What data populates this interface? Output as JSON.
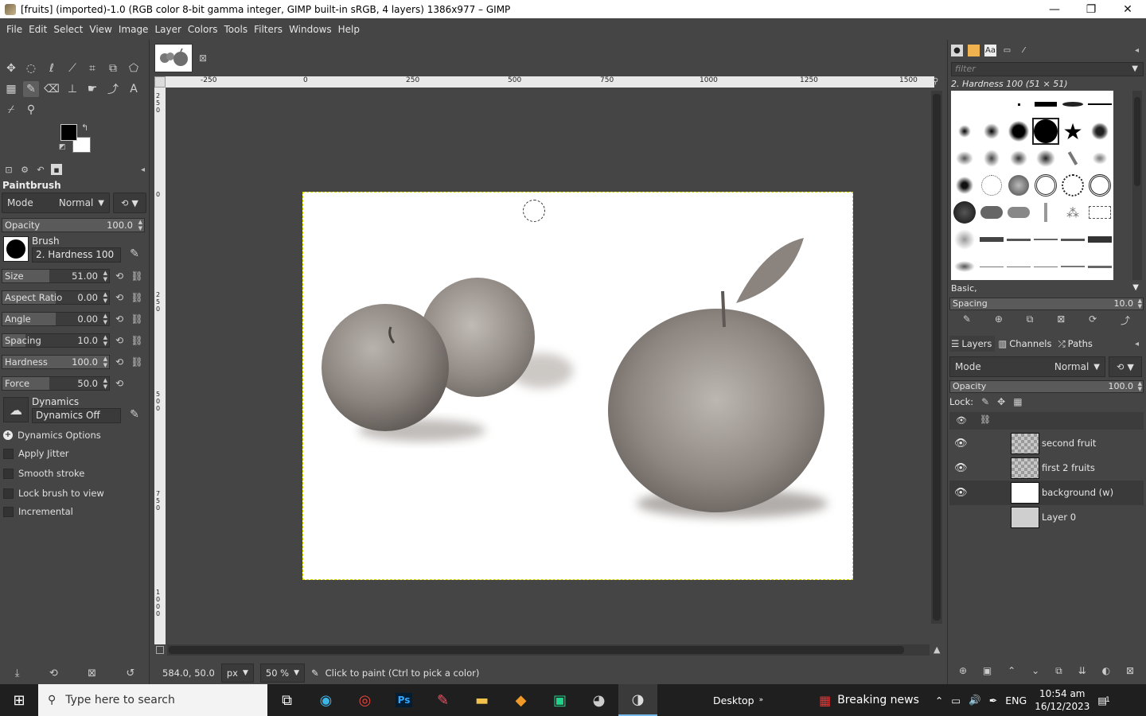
{
  "window": {
    "title": "[fruits] (imported)-1.0 (RGB color 8-bit gamma integer, GIMP built-in sRGB, 4 layers) 1386x977 – GIMP",
    "minimize": "—",
    "restore": "❐",
    "close": "✕"
  },
  "menu": [
    "File",
    "Edit",
    "Select",
    "View",
    "Image",
    "Layer",
    "Colors",
    "Tools",
    "Filters",
    "Windows",
    "Help"
  ],
  "tool_options": {
    "title": "Paintbrush",
    "mode_label": "Mode",
    "mode_value": "Normal",
    "opacity_label": "Opacity",
    "opacity_value": "100.0",
    "brush_label": "Brush",
    "brush_name": "2. Hardness 100",
    "size_label": "Size",
    "size_value": "51.00",
    "aspect_label": "Aspect Ratio",
    "aspect_value": "0.00",
    "angle_label": "Angle",
    "angle_value": "0.00",
    "spacing_label": "Spacing",
    "spacing_value": "10.0",
    "hardness_label": "Hardness",
    "hardness_value": "100.0",
    "force_label": "Force",
    "force_value": "50.0",
    "dynamics_label": "Dynamics",
    "dynamics_name": "Dynamics Off",
    "dynamics_options": "Dynamics Options",
    "apply_jitter": "Apply Jitter",
    "smooth_stroke": "Smooth stroke",
    "lock_brush": "Lock brush to view",
    "incremental": "Incremental"
  },
  "rulers": {
    "top": [
      "-250",
      "0",
      "250",
      "500",
      "750",
      "1000",
      "1250",
      "1500"
    ],
    "left": [
      "250",
      "0",
      "250",
      "500",
      "750",
      "1000"
    ]
  },
  "status": {
    "coords": "584.0, 50.0",
    "unit": "px",
    "zoom": "50 %",
    "message": "Click to paint (Ctrl to pick a color)"
  },
  "brushes": {
    "filter_placeholder": "filter",
    "selected": "2. Hardness 100 (51 × 51)",
    "tag": "Basic,",
    "spacing_label": "Spacing",
    "spacing_value": "10.0"
  },
  "layers_panel": {
    "tabs": [
      "Layers",
      "Channels",
      "Paths"
    ],
    "mode_label": "Mode",
    "mode_value": "Normal",
    "opacity_label": "Opacity",
    "opacity_value": "100.0",
    "lock_label": "Lock:",
    "layers": [
      {
        "name": "second fruit",
        "visible": true
      },
      {
        "name": "first 2 fruits",
        "visible": true
      },
      {
        "name": "background (w)",
        "visible": true
      },
      {
        "name": "Layer 0",
        "visible": false
      }
    ]
  },
  "taskbar": {
    "search_placeholder": "Type here to search",
    "desktop": "Desktop",
    "news": "Breaking news",
    "lang": "ENG",
    "time": "10:54 am",
    "date": "16/12/2023",
    "notif_count": "1"
  }
}
